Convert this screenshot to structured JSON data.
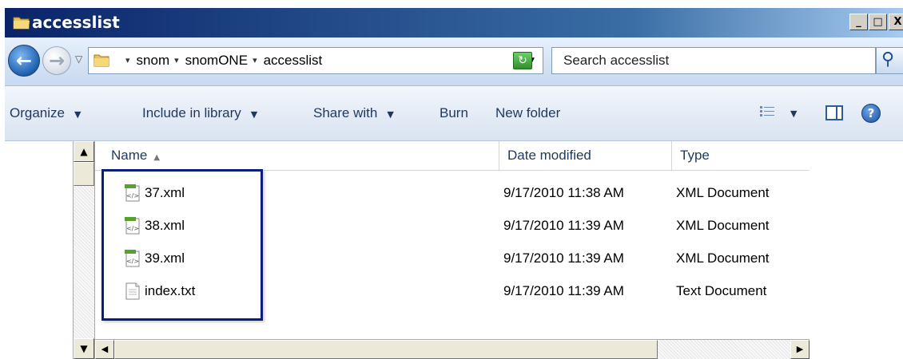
{
  "window": {
    "title": "accesslist"
  },
  "caption_buttons": {
    "minimize": "_",
    "maximize": "□",
    "close": "X"
  },
  "nav": {
    "back_glyph": "←",
    "forward_glyph": "→",
    "recent_glyph": "▽",
    "breadcrumbs": [
      "snom",
      "snomONE",
      "accesslist"
    ],
    "crumb_separator": "▾",
    "address_dropdown": "▼",
    "refresh_glyph": "↻",
    "search_placeholder": "Search accesslist",
    "search_glyph": "⚲"
  },
  "toolbar": {
    "organize": "Organize",
    "include_in_library": "Include in library",
    "share_with": "Share with",
    "burn": "Burn",
    "new_folder": "New folder",
    "caret": "▼",
    "help_glyph": "?"
  },
  "columns": {
    "name": "Name",
    "date_modified": "Date modified",
    "type": "Type",
    "sort_glyph": "▲"
  },
  "files": [
    {
      "name": "37.xml",
      "date": "9/17/2010 11:38 AM",
      "type": "XML Document",
      "icon": "xml-file-icon"
    },
    {
      "name": "38.xml",
      "date": "9/17/2010 11:39 AM",
      "type": "XML Document",
      "icon": "xml-file-icon"
    },
    {
      "name": "39.xml",
      "date": "9/17/2010 11:39 AM",
      "type": "XML Document",
      "icon": "xml-file-icon"
    },
    {
      "name": "index.txt",
      "date": "9/17/2010 11:39 AM",
      "type": "Text Document",
      "icon": "text-file-icon"
    }
  ],
  "scroll": {
    "up": "▲",
    "down": "▼",
    "left": "◀",
    "right": "▶"
  },
  "colors": {
    "title_bar": "#0a246a",
    "highlight_box": "#0a1e7a",
    "toolbar_text": "#1e395b"
  }
}
